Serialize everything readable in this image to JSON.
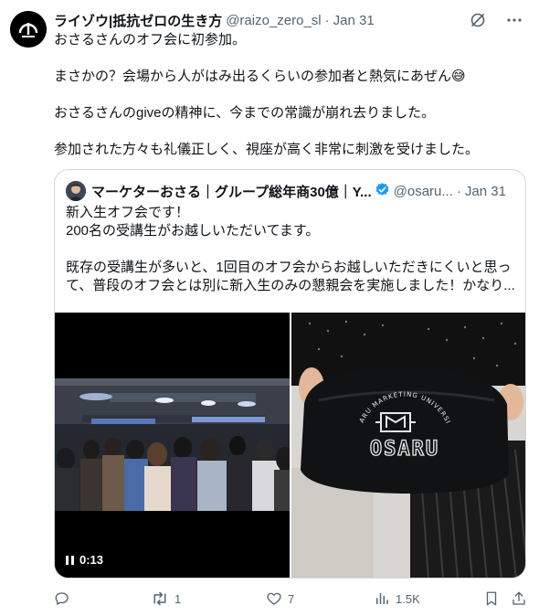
{
  "tweet": {
    "author_name": "ライゾウ|抵抗ゼロの生き方",
    "author_handle": "@raizo_zero_sl",
    "separator": "·",
    "time": "Jan 31",
    "lines": [
      "おさるさんのオフ会に初参加。",
      "まさかの？会場から人がはみ出るくらいの参加者と熱気にあぜん😅",
      "おさるさんのgiveの精神に、今までの常識が崩れ去りました。",
      "参加された方々も礼儀正しく、視座が高く非常に刺激を受けました。"
    ]
  },
  "quote": {
    "author_name": "マーケターおさる｜グループ総年商30億｜Y...",
    "author_handle": "@osaru...",
    "separator": "·",
    "time": "Jan 31",
    "lines": [
      "新入生オフ会です！",
      "200名の受講生がお越しいただいてます。",
      "既存の受講生が多いと、1回目のオフ会からお越しいただきにくいと思っ",
      "て、普段のオフ会とは別に新入生のみの懇親会を実施しました！かなり..."
    ],
    "video_time": "0:13",
    "bag_text": {
      "brand": "OSARU",
      "arc": "OSARU MARKETING UNIVERSITY"
    }
  },
  "actions": {
    "retweets": "1",
    "likes": "7",
    "views": "1.5K"
  },
  "colors": {
    "text": "#0f1419",
    "muted": "#536471",
    "border": "#cfd9de",
    "verified": "#1d9bf0"
  }
}
